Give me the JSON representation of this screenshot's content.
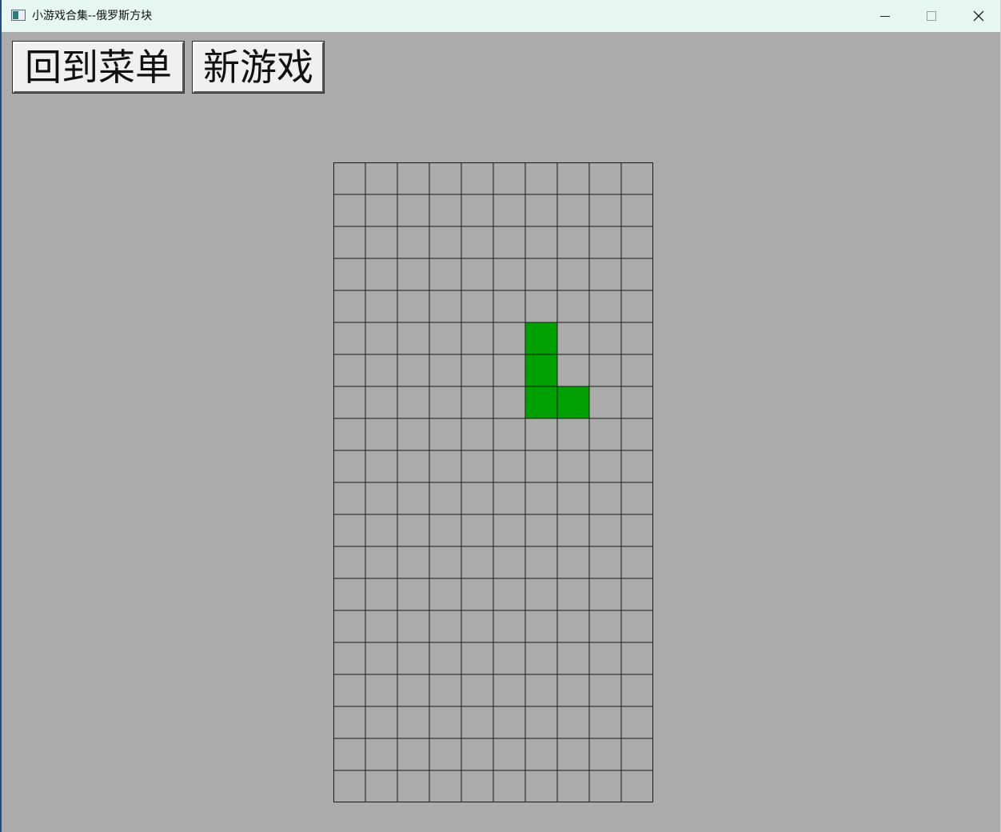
{
  "window": {
    "title": "小游戏合集--俄罗斯方块"
  },
  "title_controls": {
    "minimize_icon": "minimize-icon",
    "maximize_icon": "maximize-icon",
    "close_icon": "close-icon"
  },
  "toolbar": {
    "menu_label": "回到菜单",
    "new_game_label": "新游戏"
  },
  "board": {
    "columns": 10,
    "rows": 20,
    "grid_line_color": "#1a1a1a",
    "background_color": "#ababab",
    "active_piece": {
      "shape": "L",
      "color": "#00a000",
      "cells": [
        {
          "col": 6,
          "row": 5
        },
        {
          "col": 6,
          "row": 6
        },
        {
          "col": 6,
          "row": 7
        },
        {
          "col": 7,
          "row": 7
        }
      ]
    }
  }
}
